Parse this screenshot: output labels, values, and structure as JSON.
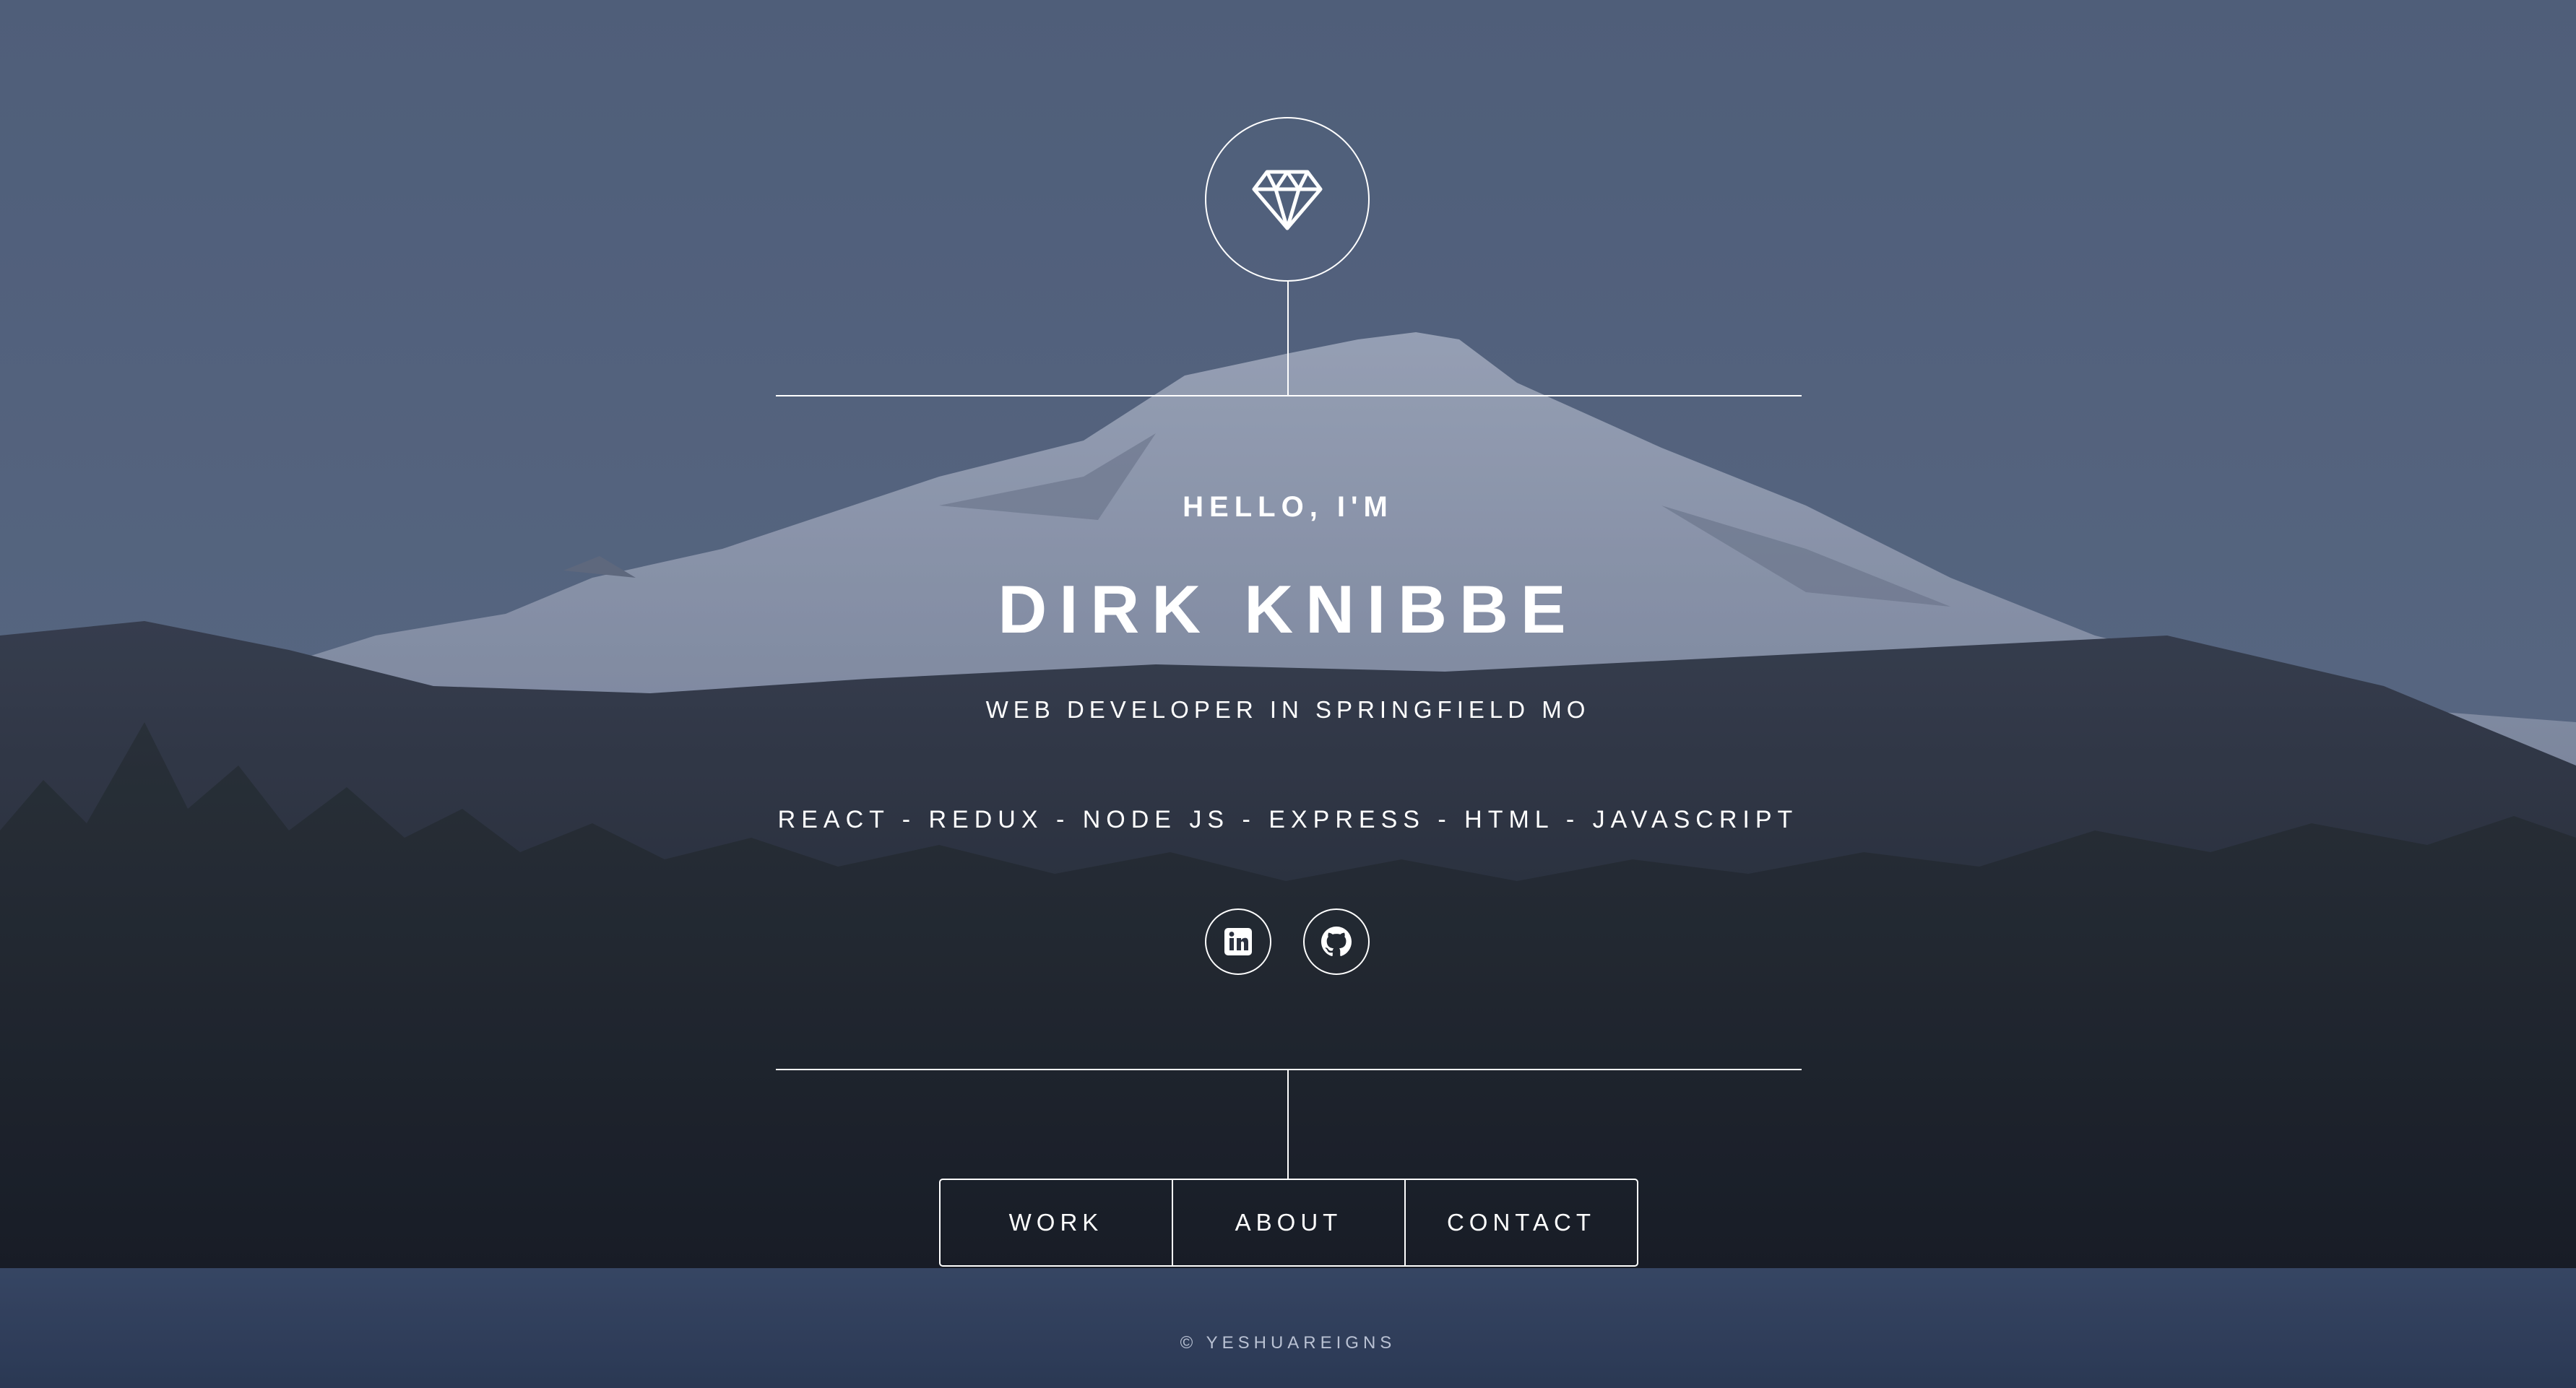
{
  "hero": {
    "emblem_icon": "diamond-icon",
    "greeting": "HELLO, I'M",
    "name": "DIRK KNIBBE",
    "role": "WEB DEVELOPER IN SPRINGFIELD MO",
    "skills": "REACT - REDUX - NODE JS - EXPRESS - HTML - JAVASCRIPT"
  },
  "social": [
    {
      "icon": "linkedin-icon"
    },
    {
      "icon": "github-icon"
    }
  ],
  "nav": {
    "items": [
      {
        "label": "WORK"
      },
      {
        "label": "ABOUT"
      },
      {
        "label": "CONTACT"
      }
    ]
  },
  "footer": {
    "copyright": "© YESHUAREIGNS"
  },
  "colors": {
    "sky": "#56657f",
    "forest": "#1c1f26",
    "lake": "#2e3b54",
    "foreground": "#ffffff"
  }
}
